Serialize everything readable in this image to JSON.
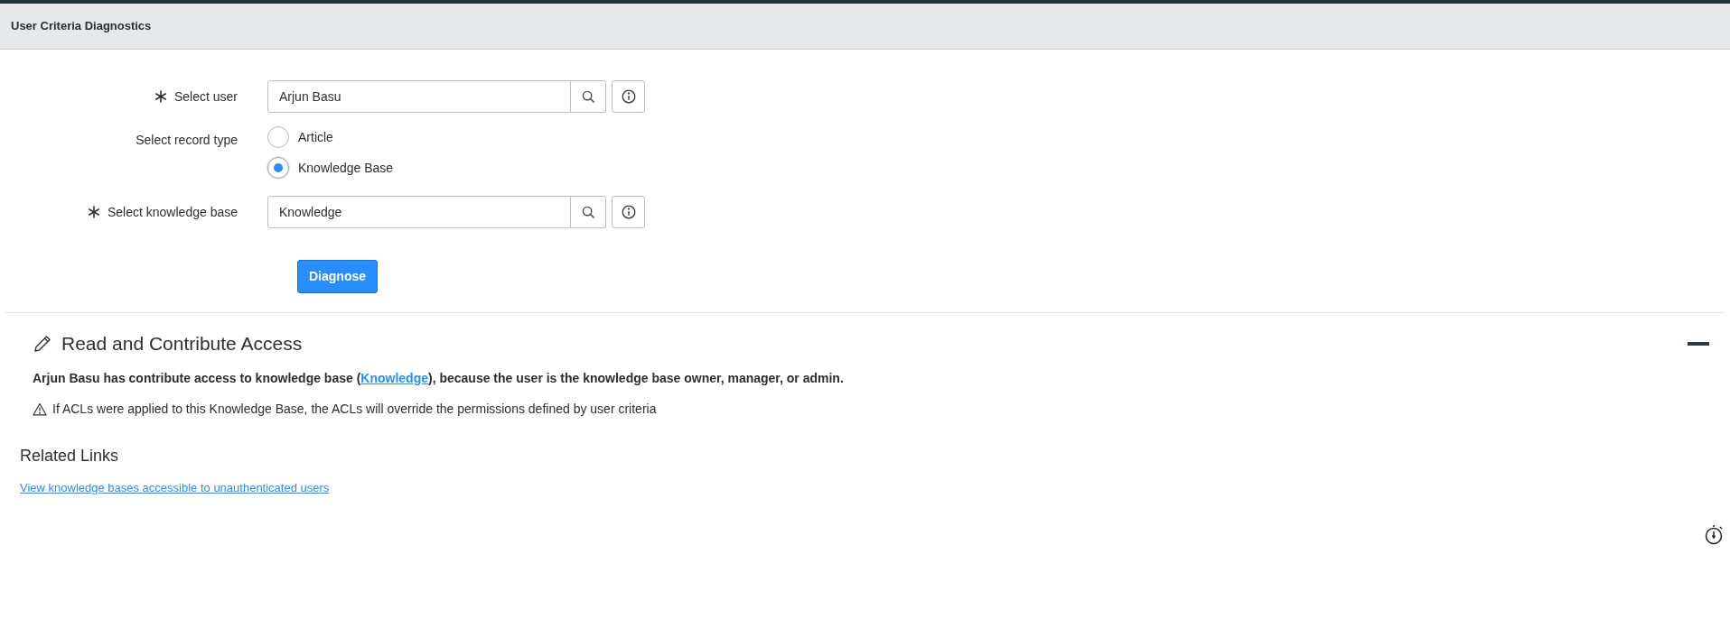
{
  "header": {
    "title": "User Criteria Diagnostics"
  },
  "form": {
    "user": {
      "label": "Select user",
      "required": true,
      "value": "Arjun Basu"
    },
    "record_type": {
      "label": "Select record type",
      "options": [
        {
          "label": "Article",
          "selected": false
        },
        {
          "label": "Knowledge Base",
          "selected": true
        }
      ]
    },
    "knowledge_base": {
      "label": "Select knowledge base",
      "required": true,
      "value": "Knowledge"
    },
    "button": "Diagnose"
  },
  "result": {
    "title": "Read and Contribute Access",
    "expanded": true,
    "message": {
      "before": "Arjun Basu has contribute access to knowledge base (",
      "link": "Knowledge",
      "after": "), because the user is the knowledge base owner, manager, or admin."
    },
    "warning": "If ACLs were applied to this Knowledge Base, the ACLs will override the permissions defined by user criteria"
  },
  "related_links": {
    "title": "Related Links",
    "links": [
      "View knowledge bases accessible to unauthenticated users"
    ]
  }
}
